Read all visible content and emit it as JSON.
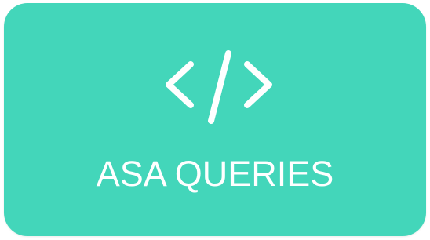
{
  "tile": {
    "label": "ASA QUERIES",
    "icon": "code-icon",
    "background_color": "#43d6ba",
    "text_color": "#ffffff"
  }
}
